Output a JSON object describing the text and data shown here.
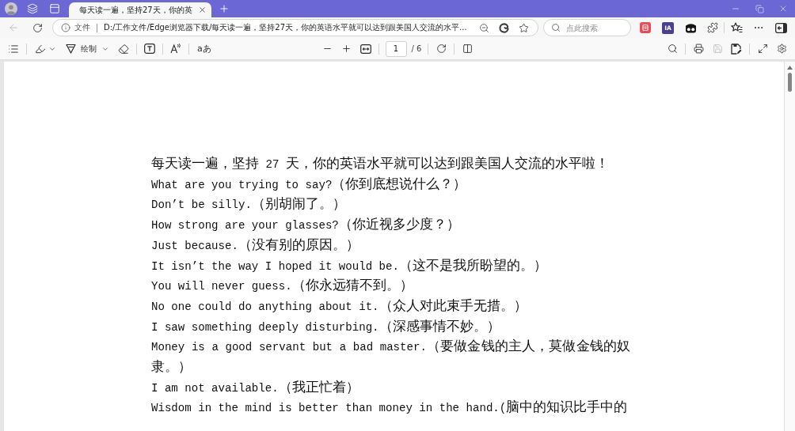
{
  "browser_tabs": [
    {
      "title": "每天读一遍，坚持27天，你的英",
      "selected": true
    }
  ],
  "address_bar": {
    "back_disabled": true,
    "scheme_label": "文件",
    "url": "D:/工作文件/Edge浏览器下载/每天读一遍，坚持27天，你的英语水平就可以达到跟美国人交流的水平..."
  },
  "search": {
    "placeholder": "点此搜索"
  },
  "extensions": [
    {
      "kind": "badge"
    },
    {
      "kind": "letters",
      "label": "IA"
    },
    {
      "kind": "mask"
    },
    {
      "kind": "puzzle"
    }
  ],
  "pdf_toolbar": {
    "draw_label": "绘制",
    "translate_label": "aあ",
    "page_number": "1",
    "page_count": "/ 6",
    "save_disabled": true
  },
  "document": {
    "paragraphs": [
      "每天读一遍，坚持 27 天，你的英语水平就可以达到跟美国人交流的水平啦！",
      "What are you trying to say?（你到底想说什么？）",
      "Don’t be silly.（别胡闹了。）",
      "How strong are your glasses?（你近视多少度？）",
      "Just because.（没有别的原因。）",
      "It isn’t the way I hoped it would be.（这不是我所盼望的。）",
      "You will never guess.（你永远猜不到。）",
      "No one could do anything about it.（众人对此束手无措。）",
      "I saw something deeply disturbing.（深感事情不妙。）",
      "Money is a good servant but a bad master.（要做金钱的主人，莫做金钱的奴隶。）",
      "I am not available.（我正忙着）",
      "Wisdom in the mind is better than money in the hand.(脑中的知识比手中的"
    ]
  }
}
